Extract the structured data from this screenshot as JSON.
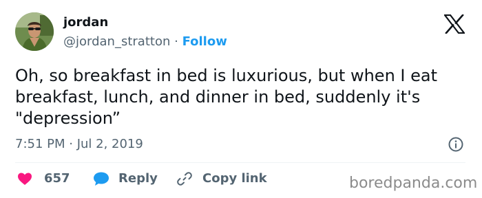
{
  "author": {
    "name": "jordan",
    "handle": "@jordan_stratton",
    "separator": "·",
    "follow_label": "Follow"
  },
  "tweet": {
    "text": "Oh, so breakfast in bed is luxurious, but when I eat breakfast, lunch, and dinner in bed, suddenly it's \"depression”",
    "timestamp": "7:51 PM · Jul 2, 2019"
  },
  "actions": {
    "likes_count": "657",
    "reply_label": "Reply",
    "copy_link_label": "Copy link"
  },
  "watermark": "boredpanda.com",
  "icons": {
    "brand": "x-logo-icon",
    "info": "info-icon",
    "like": "heart-icon",
    "reply": "reply-bubble-icon",
    "copy_link": "link-icon"
  },
  "colors": {
    "link_blue": "#1d9bf0",
    "like_pink": "#f91880",
    "muted_gray": "#536471",
    "text": "#0f1419"
  }
}
